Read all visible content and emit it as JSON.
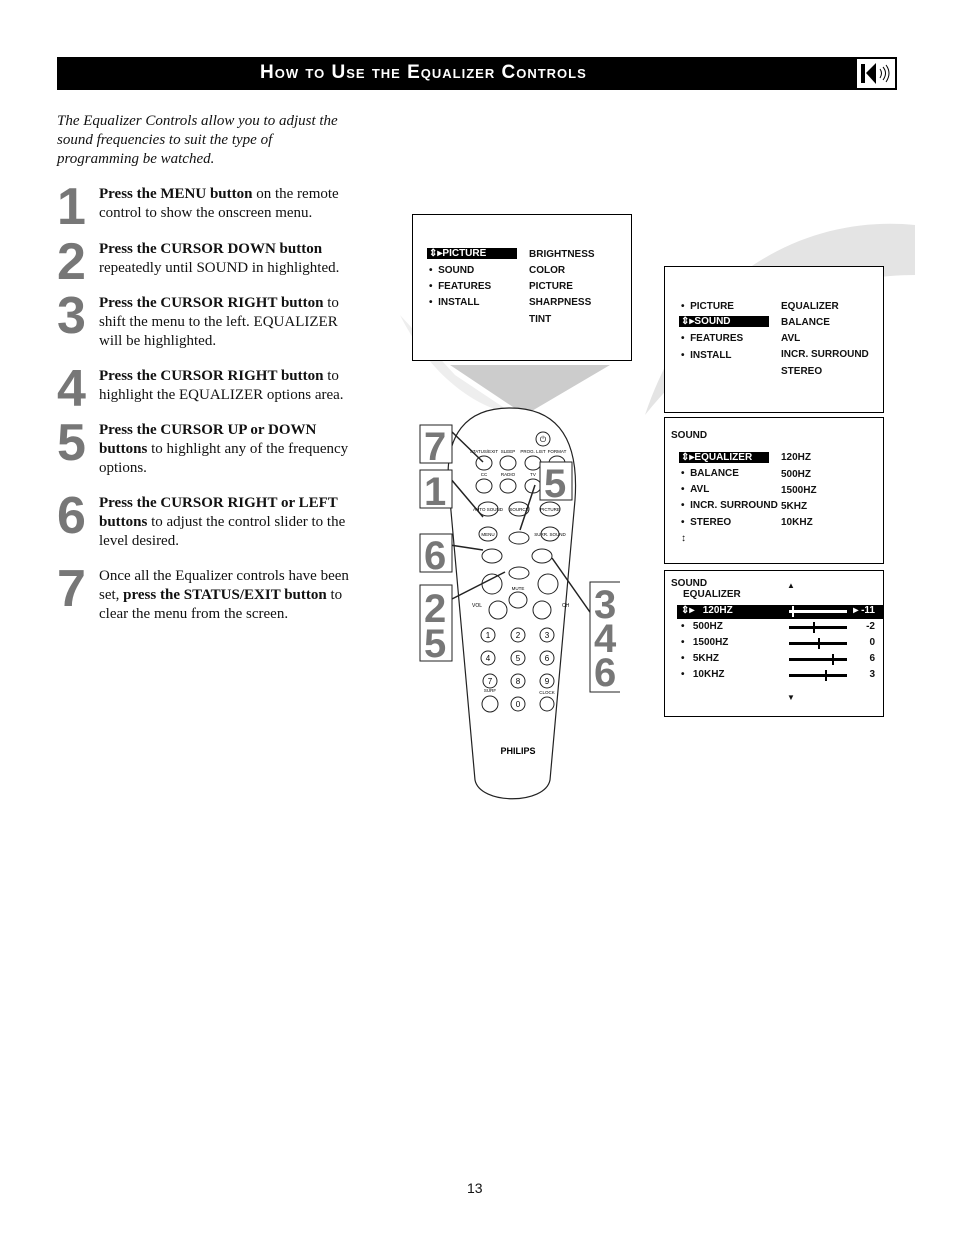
{
  "header": {
    "title": "How to Use the Equalizer Controls",
    "icon": "speaker-sound-icon"
  },
  "intro": "The Equalizer Controls allow you to adjust the sound frequencies to suit the type of programming be watched.",
  "steps": [
    {
      "num": "1",
      "bold": "Press the MENU button",
      "rest": " on the remote control to show the onscreen menu."
    },
    {
      "num": "2",
      "bold": "Press the CURSOR DOWN button",
      "rest": " repeatedly until SOUND in highlighted."
    },
    {
      "num": "3",
      "bold": "Press the CURSOR RIGHT button",
      "rest": " to shift the menu to the left. EQUALIZER will be highlighted."
    },
    {
      "num": "4",
      "bold": "Press the CURSOR RIGHT button",
      "rest": " to highlight the EQUALIZER options area."
    },
    {
      "num": "5",
      "bold": "Press the CURSOR UP or DOWN buttons",
      "rest": " to highlight any of the frequency options."
    },
    {
      "num": "6",
      "bold": "Press the CURSOR RIGHT or LEFT buttons",
      "rest": " to adjust the control slider to the level desired."
    },
    {
      "num": "7",
      "pre": "Once all the Equalizer controls have been set, ",
      "bold": "press the STATUS/EXIT button",
      "rest": " to clear the menu from the screen."
    }
  ],
  "menu1": {
    "left": [
      "PICTURE",
      "SOUND",
      "FEATURES",
      "INSTALL"
    ],
    "right": [
      "BRIGHTNESS",
      "COLOR",
      "PICTURE",
      "SHARPNESS",
      "TINT"
    ]
  },
  "menu2": {
    "left": [
      "PICTURE",
      "SOUND",
      "FEATURES",
      "INSTALL"
    ],
    "right": [
      "EQUALIZER",
      "BALANCE",
      "AVL",
      "INCR. SURROUND",
      "STEREO"
    ]
  },
  "menu3": {
    "title": "SOUND",
    "left": [
      "EQUALIZER",
      "BALANCE",
      "AVL",
      "INCR. SURROUND",
      "STEREO"
    ],
    "right": [
      "120HZ",
      "500HZ",
      "1500HZ",
      "5KHZ",
      "10KHZ"
    ]
  },
  "menu4": {
    "title": "SOUND",
    "subtitle": "EQUALIZER",
    "bands": [
      {
        "label": "120HZ",
        "value": "-11",
        "level": -11
      },
      {
        "label": "500HZ",
        "value": "-2",
        "level": -2
      },
      {
        "label": "1500HZ",
        "value": "0",
        "level": 0
      },
      {
        "label": "5KHZ",
        "value": "6",
        "level": 6
      },
      {
        "label": "10KHZ",
        "value": "3",
        "level": 3
      }
    ]
  },
  "remote": {
    "brand": "PHILIPS",
    "buttons": [
      "STATUS/EXIT",
      "SLEEP",
      "PROG. LIST",
      "FORMAT",
      "CC",
      "RADIO",
      "TV",
      "AUTO SOUND",
      "SOURCE",
      "PICTURE",
      "MENU",
      "SURR. SOUND",
      "MUTE",
      "VOL",
      "CH",
      "SURF",
      "CLOCK"
    ],
    "digits": [
      "1",
      "2",
      "3",
      "4",
      "5",
      "6",
      "7",
      "8",
      "9",
      "0"
    ],
    "callouts": [
      "7",
      "1",
      "6",
      "2 5",
      "5",
      "3 4 6"
    ]
  },
  "page_number": "13"
}
